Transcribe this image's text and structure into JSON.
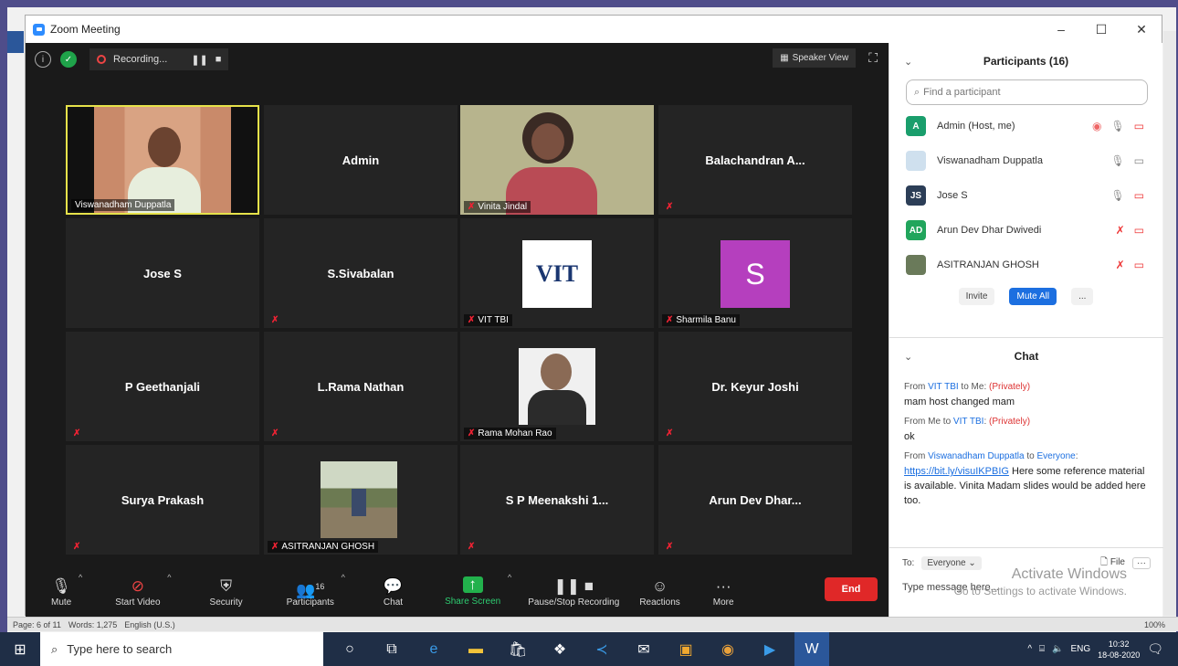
{
  "window_title": "Zoom Meeting",
  "recording_label": "Recording...",
  "speaker_view_label": "Speaker View",
  "tiles": [
    {
      "name": "Viswanadham Duppatla",
      "video": true,
      "muted": false
    },
    {
      "name": "Admin",
      "video": false,
      "muted": false
    },
    {
      "name": "Vinita Jindal",
      "video": true,
      "muted": true
    },
    {
      "name": "Balachandran A...",
      "video": false,
      "muted": true
    },
    {
      "name": "Jose S",
      "video": false,
      "muted": false
    },
    {
      "name": "S.Sivabalan",
      "video": false,
      "muted": true
    },
    {
      "name": "VIT TBI",
      "video": true,
      "muted": true
    },
    {
      "name": "Sharmila Banu",
      "video": true,
      "muted": true
    },
    {
      "name": "P Geethanjali",
      "video": false,
      "muted": true
    },
    {
      "name": "L.Rama Nathan",
      "video": false,
      "muted": true
    },
    {
      "name": "Rama Mohan Rao",
      "video": true,
      "muted": true
    },
    {
      "name": "Dr. Keyur Joshi",
      "video": false,
      "muted": true
    },
    {
      "name": "Surya Prakash",
      "video": false,
      "muted": true
    },
    {
      "name": "ASITRANJAN GHOSH",
      "video": true,
      "muted": true
    },
    {
      "name": "S P Meenakshi 1...",
      "video": false,
      "muted": true
    },
    {
      "name": "Arun Dev Dhar...",
      "video": false,
      "muted": true
    }
  ],
  "vit_logo_text": "VIT",
  "sharmila_initial": "S",
  "toolbar": {
    "mute": "Mute",
    "start_video": "Start Video",
    "security": "Security",
    "participants": "Participants",
    "participants_count": "16",
    "chat": "Chat",
    "share_screen": "Share Screen",
    "pause_recording": "Pause/Stop Recording",
    "reactions": "Reactions",
    "more": "More",
    "end": "End"
  },
  "panel": {
    "participants_title": "Participants (16)",
    "search_placeholder": "Find a participant",
    "participants": [
      {
        "initials": "A",
        "name": "Admin (Host, me)",
        "color": "#1a9e6c"
      },
      {
        "initials": "",
        "name": "Viswanadham Duppatla",
        "color": "#cfe0ee"
      },
      {
        "initials": "JS",
        "name": "Jose S",
        "color": "#2c3e57"
      },
      {
        "initials": "AD",
        "name": "Arun Dev Dhar Dwivedi",
        "color": "#21a55c"
      },
      {
        "initials": "",
        "name": "ASITRANJAN GHOSH",
        "color": "#6a7a5a"
      }
    ],
    "invite": "Invite",
    "mute_all": "Mute All",
    "more": "...",
    "chat_title": "Chat",
    "messages": [
      {
        "from": "VIT TBI",
        "to": "Me",
        "privately": "(Privately)",
        "body": "mam host changed mam"
      },
      {
        "from": "Me",
        "to": "VIT TBI",
        "privately": "(Privately)",
        "body": "ok"
      },
      {
        "from": "Viswanadham Duppatla",
        "to": "Everyone",
        "link": "https://bit.ly/visuIKPBIG",
        "body": " Here some reference material is available. Vinita Madam slides would be added here too."
      }
    ],
    "to_label": "To:",
    "to_value": "Everyone",
    "file_label": "File",
    "input_placeholder": "Type message here...",
    "activate": "Activate Windows",
    "activate_sub": "Go to Settings to activate Windows."
  },
  "word_status": {
    "page": "Page: 6 of 11",
    "words": "Words: 1,275",
    "lang": "English (U.S.)",
    "zoom": "100%"
  },
  "taskbar": {
    "search": "Type here to search",
    "lang": "ENG",
    "time": "10:32",
    "date": "18-08-2020"
  }
}
